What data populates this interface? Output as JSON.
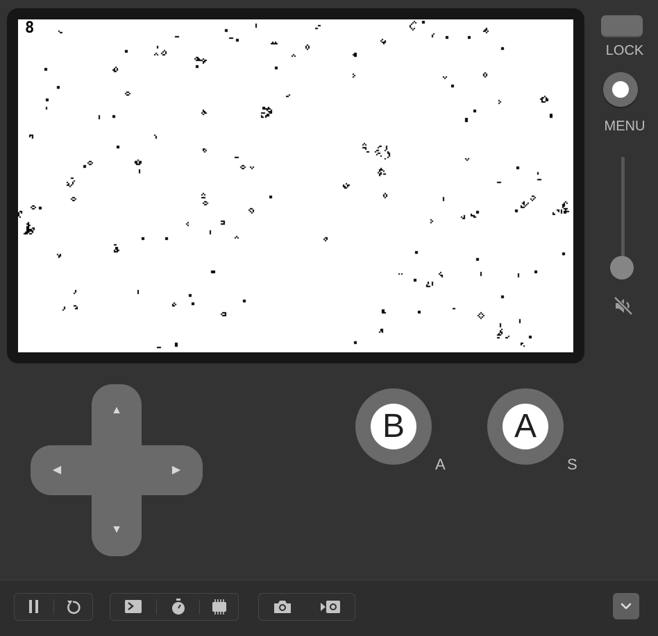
{
  "screen": {
    "fps_counter": "8",
    "background_color": "#ffffff",
    "cell_color": "#000000"
  },
  "side_controls": {
    "lock_label": "LOCK",
    "menu_label": "MENU",
    "volume_muted": true,
    "mute_icon": "speaker-muted-icon"
  },
  "dpad": {
    "up_icon": "▲",
    "down_icon": "▼",
    "left_icon": "◀",
    "right_icon": "▶"
  },
  "buttons": {
    "b": {
      "label": "B",
      "key_hint": "A"
    },
    "a": {
      "label": "A",
      "key_hint": "S"
    }
  },
  "toolbar": {
    "icons": [
      "pause-icon",
      "restart-icon",
      "console-icon",
      "stopwatch-icon",
      "cpu-chip-icon",
      "camera-icon",
      "record-video-icon",
      "chevron-down-icon"
    ]
  },
  "colors": {
    "body": "#333333",
    "bezel": "#161616",
    "button": "#6a6a6a",
    "label": "#bdbdbd"
  }
}
